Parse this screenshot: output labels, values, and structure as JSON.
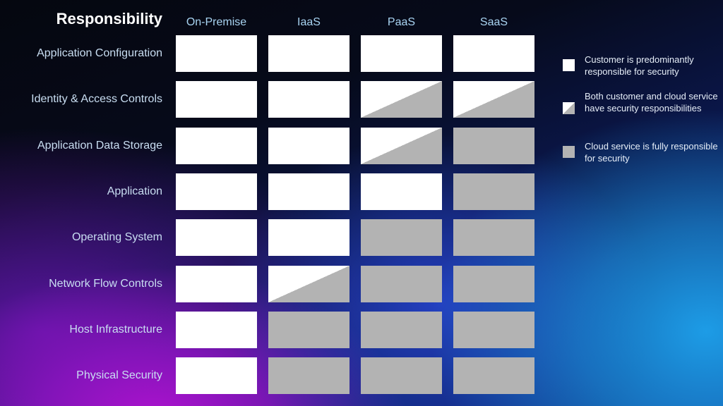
{
  "header": {
    "title": "Responsibility",
    "columns": [
      "On-Premise",
      "IaaS",
      "PaaS",
      "SaaS"
    ]
  },
  "rows": [
    {
      "label": "Application Configuration",
      "cells": [
        "customer",
        "customer",
        "customer",
        "customer"
      ]
    },
    {
      "label": "Identity & Access Controls",
      "cells": [
        "customer",
        "customer",
        "shared",
        "shared"
      ]
    },
    {
      "label": "Application Data Storage",
      "cells": [
        "customer",
        "customer",
        "shared",
        "cloud"
      ]
    },
    {
      "label": "Application",
      "cells": [
        "customer",
        "customer",
        "customer",
        "cloud"
      ]
    },
    {
      "label": "Operating System",
      "cells": [
        "customer",
        "customer",
        "cloud",
        "cloud"
      ]
    },
    {
      "label": "Network Flow Controls",
      "cells": [
        "customer",
        "shared",
        "cloud",
        "cloud"
      ]
    },
    {
      "label": "Host Infrastructure",
      "cells": [
        "customer",
        "cloud",
        "cloud",
        "cloud"
      ]
    },
    {
      "label": "Physical Security",
      "cells": [
        "customer",
        "cloud",
        "cloud",
        "cloud"
      ]
    }
  ],
  "legend": [
    {
      "key": "customer",
      "text": "Customer is predominantly responsible for security"
    },
    {
      "key": "shared",
      "text": "Both customer and cloud service have security responsibilities"
    },
    {
      "key": "cloud",
      "text": "Cloud service is fully responsible for security"
    }
  ],
  "colors": {
    "customer": "#ffffff",
    "cloud": "#b3b3b3",
    "header_text": "#a9d4f2",
    "row_label_text": "#c9def2"
  }
}
